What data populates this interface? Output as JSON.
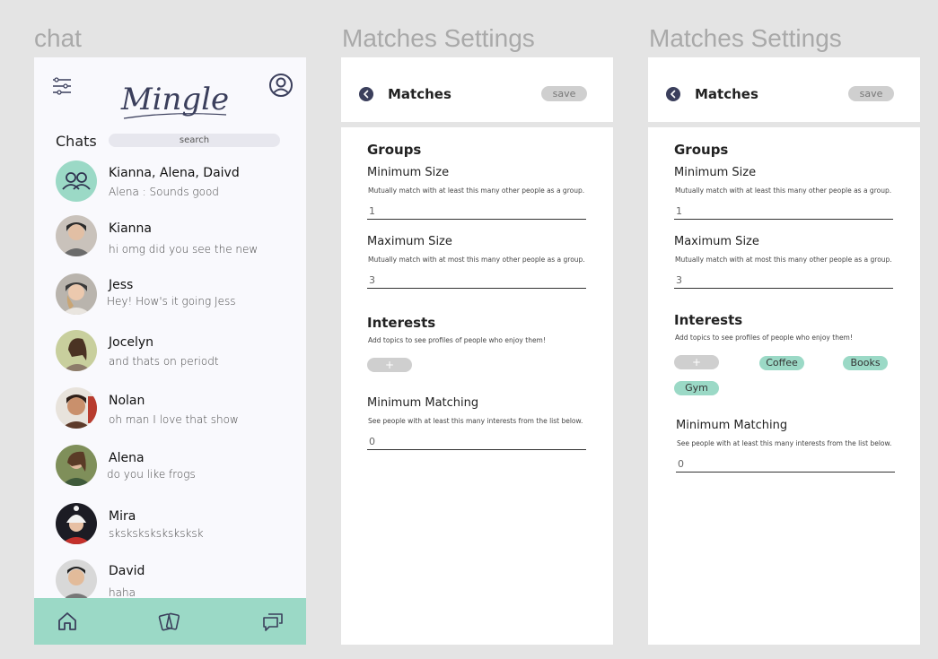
{
  "frames": {
    "chat_label": "chat",
    "settings1_label": "Matches Settings",
    "settings2_label": "Matches Settings"
  },
  "chat": {
    "logo": "Mingle",
    "chats_title": "Chats",
    "search_placeholder": "search",
    "items": [
      {
        "name": "Kianna, Alena, Daivd",
        "message": "Alena : Sounds good"
      },
      {
        "name": "Kianna",
        "message": "hi omg did you see the new"
      },
      {
        "name": "Jess",
        "message": "Hey! How's it going Jess"
      },
      {
        "name": "Jocelyn",
        "message": "and thats on periodt"
      },
      {
        "name": "Nolan",
        "message": "oh man I love that show"
      },
      {
        "name": "Alena",
        "message": "do you like frogs"
      },
      {
        "name": "Mira",
        "message": "sksksksksksksksk"
      },
      {
        "name": "David",
        "message": "haha"
      }
    ],
    "nav": [
      "home-icon",
      "cards-icon",
      "chat-bubbles-icon"
    ]
  },
  "settings": {
    "title": "Matches",
    "save": "save",
    "groups_title": "Groups",
    "min_size_label": "Minimum Size",
    "min_size_help": "Mutually match with at least this many other people as a group.",
    "min_size_value": "1",
    "max_size_label": "Maximum Size",
    "max_size_help": "Mutually match with at most this many other people as a group.",
    "max_size_value": "3",
    "interests_title": "Interests",
    "interests_help": "Add topics to see profiles of people who enjoy them!",
    "add_label": "+",
    "min_matching_label": "Minimum Matching",
    "min_matching_help": "See people with at least this many interests from the list below.",
    "min_matching_value": "0"
  },
  "settings2": {
    "interests": [
      "Coffee",
      "Books",
      "Gym"
    ]
  },
  "colors": {
    "accent": "#9bd9c6",
    "pill_gray": "#cfcfcf",
    "icon_dark": "#3b3f5c"
  }
}
